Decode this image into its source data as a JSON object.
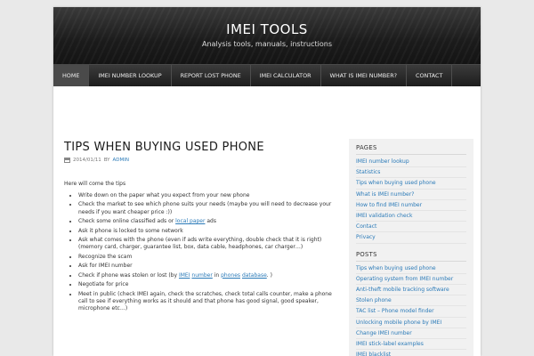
{
  "site": {
    "title": "IMEI TOOLS",
    "description": "Analysis tools, manuals, instructions"
  },
  "nav": [
    {
      "label": "HOME",
      "active": true
    },
    {
      "label": "IMEI NUMBER LOOKUP"
    },
    {
      "label": "REPORT LOST PHONE"
    },
    {
      "label": "IMEI CALCULATOR"
    },
    {
      "label": "WHAT IS IMEI NUMBER?"
    },
    {
      "label": "CONTACT"
    }
  ],
  "post": {
    "title": "TIPS WHEN BUYING USED PHONE",
    "date": "2014/01/11",
    "by": "BY",
    "author": "ADMIN",
    "intro": "Here will come the tips",
    "tips": [
      {
        "parts": [
          {
            "t": "Write down on the paper what you expect from your new phone"
          }
        ]
      },
      {
        "parts": [
          {
            "t": "Check the market to see which phone suits your needs (maybe you will need to decrease your needs if you want cheaper price :))"
          }
        ]
      },
      {
        "parts": [
          {
            "t": "Check some online classified ads or "
          },
          {
            "t": "local paper",
            "link": true
          },
          {
            "t": " ads"
          }
        ]
      },
      {
        "parts": [
          {
            "t": "Ask it phone is locked to some network"
          }
        ]
      },
      {
        "parts": [
          {
            "t": "Ask what comes with the phone (even if ads write everything, double check that it is right) (memory card, charger, guarantee list, box, data cable, headphones, car charger…)"
          }
        ]
      },
      {
        "parts": [
          {
            "t": "Recognize the scam"
          }
        ]
      },
      {
        "parts": [
          {
            "t": "Ask for IMEI number"
          }
        ]
      },
      {
        "parts": [
          {
            "t": "Check if phone was stolen or lost (by "
          },
          {
            "t": "IMEI",
            "link": true
          },
          {
            "t": " "
          },
          {
            "t": "number",
            "link": true
          },
          {
            "t": " in "
          },
          {
            "t": "phones",
            "link": true
          },
          {
            "t": " "
          },
          {
            "t": "database",
            "link": true
          },
          {
            "t": ". )"
          }
        ]
      },
      {
        "parts": [
          {
            "t": "Negotiate for price"
          }
        ]
      },
      {
        "parts": [
          {
            "t": "Meet in public (check IMEI again, check the scratches, check total calls counter, make a phone call to see if everything works as it should and that phone has good signal, good speaker, microphone etc…)"
          }
        ]
      }
    ]
  },
  "sidebar": {
    "pages_title": "PAGES",
    "pages": [
      "IMEI number lookup",
      "Statistics",
      "Tips when buying used phone",
      "What is IMEI number?",
      "How to find IMEI number",
      "IMEI validation check",
      "Contact",
      "Privacy"
    ],
    "posts_title": "POSTS",
    "posts": [
      "Tips when buying used phone",
      "Operating system from IMEI number",
      "Anti-theft mobile tracking software",
      "Stolen phone",
      "TAC list – Phone model finder",
      "Unlocking mobile phone by IMEI",
      "Change IMEI number",
      "IMEI stick-label examples",
      "IMEI blacklist"
    ]
  },
  "icons": {
    "date": "calendar-icon"
  },
  "colors": {
    "link": "#2a7ab8",
    "header_bg": "#1b1b1b",
    "sidebar_bg": "#f1f1f1"
  }
}
